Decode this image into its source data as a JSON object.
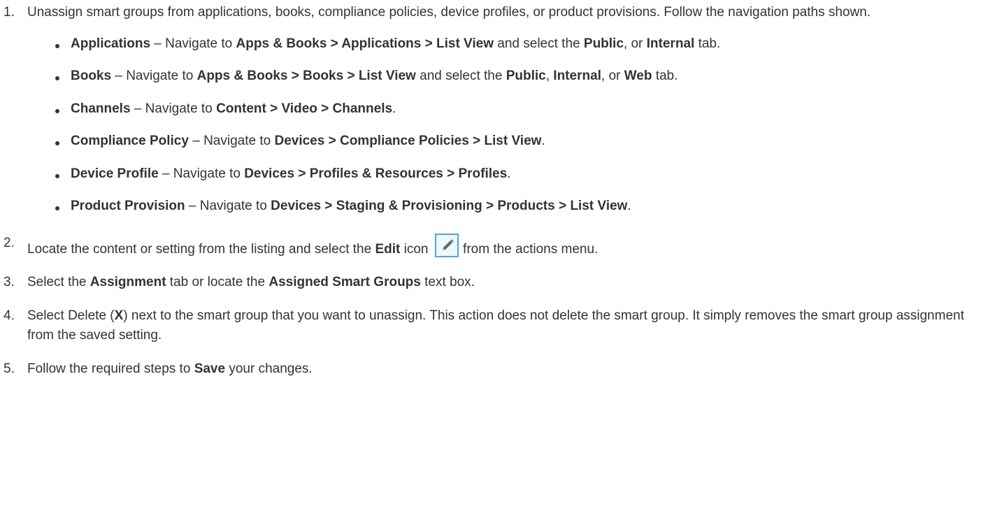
{
  "steps": [
    {
      "num": "1.",
      "text": "Unassign smart groups from applications, books, compliance policies, device profiles, or product provisions. Follow the navigation paths shown.",
      "items": [
        {
          "term": "Applications",
          "dash": " – Navigate to ",
          "path": "Apps & Books > Applications > List View",
          "mid": " and select the ",
          "tab1": "Public",
          "sep1": ", or ",
          "tab2": "Internal",
          "end": " tab."
        },
        {
          "term": "Books",
          "dash": " – Navigate to ",
          "path": "Apps & Books > Books > List View",
          "mid": " and select the ",
          "tab1": "Public",
          "sep1": ", ",
          "tab2": "Internal",
          "sep2": ", or ",
          "tab3": "Web",
          "end": " tab."
        },
        {
          "term": "Channels",
          "dash": " – Navigate to ",
          "path": "Content > Video > Channels",
          "end": "."
        },
        {
          "term": "Compliance Policy",
          "dash": " – Navigate to ",
          "path": "Devices > Compliance Policies > List View",
          "end": "."
        },
        {
          "term": "Device Profile",
          "dash": " – Navigate to ",
          "path": "Devices > Profiles & Resources > Profiles",
          "end": "."
        },
        {
          "term": "Product Provision",
          "dash": " – Navigate to ",
          "path": "Devices > Staging & Provisioning > Products > List View",
          "end": "."
        }
      ]
    },
    {
      "num": "2.",
      "pre": "Locate the content or setting from the listing and select the ",
      "bold": "Edit",
      "mid": " icon ",
      "post": " from the actions menu.",
      "icon": "pencil-edit-icon"
    },
    {
      "num": "3.",
      "pre": "Select the ",
      "bold1": "Assignment",
      "mid": " tab or locate the ",
      "bold2": "Assigned Smart Groups",
      "post": " text box."
    },
    {
      "num": "4.",
      "pre": "Select Delete (",
      "bold": "X",
      "post": ") next to the smart group that you want to unassign. This action does not delete the smart group. It simply removes the smart group assignment from the saved setting."
    },
    {
      "num": "5.",
      "pre": "Follow the required steps to ",
      "bold": "Save",
      "post": " your changes."
    }
  ],
  "colors": {
    "text": "#333333",
    "icon_border": "#4aa6dd",
    "icon_bg": "#eef7fd"
  }
}
